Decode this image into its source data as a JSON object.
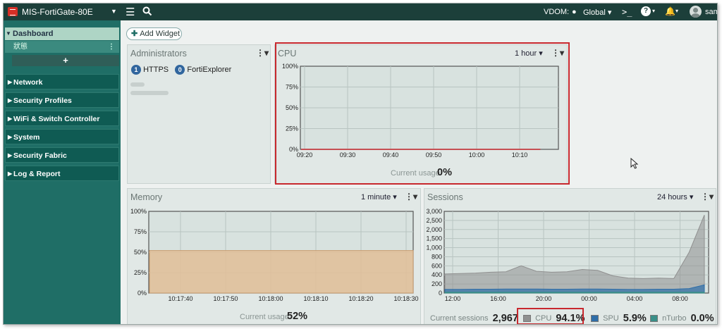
{
  "topbar": {
    "device_name": "MIS-FortiGate-80E",
    "vdom_label": "VDOM:",
    "vdom_value": "Global",
    "cli_symbol": ">_",
    "help_symbol": "?",
    "username": "sam"
  },
  "sidebar": {
    "dashboard": "Dashboard",
    "dashboard_sub": "狀態",
    "add_symbol": "+",
    "items": [
      "Network",
      "Security Profiles",
      "WiFi & Switch Controller",
      "System",
      "Security Fabric",
      "Log & Report"
    ]
  },
  "toolbar": {
    "add_widget": "Add Widget"
  },
  "widgets": {
    "administrators": {
      "title": "Administrators",
      "https_count": "1",
      "https_label": "HTTPS",
      "fe_count": "0",
      "fe_label": "FortiExplorer"
    },
    "cpu": {
      "title": "CPU",
      "range": "1 hour",
      "usage_label": "Current usage",
      "usage_value": "0%"
    },
    "memory": {
      "title": "Memory",
      "range": "1 minute",
      "usage_label": "Current usage",
      "usage_value": "52%"
    },
    "sessions": {
      "title": "Sessions",
      "range": "24 hours",
      "current_label": "Current sessions",
      "current_value": "2,967",
      "cpu_label": "CPU",
      "cpu_value": "94.1%",
      "spu_label": "SPU",
      "spu_value": "5.9%",
      "nturbo_label": "nTurbo",
      "nturbo_value": "0.0%"
    }
  },
  "colors": {
    "topbar": "#1c3f3a",
    "sidebar": "#1f6e66",
    "highlight": "#c8282e",
    "memory_fill": "#e2be98",
    "cpu_series": "#909090",
    "spu_series": "#2f6ea8",
    "nturbo_series": "#3a8f88"
  },
  "chart_data": [
    {
      "id": "cpu",
      "type": "line",
      "x": [
        "09:20",
        "09:30",
        "09:40",
        "09:50",
        "10:00",
        "10:10"
      ],
      "y_ticks": [
        "0%",
        "25%",
        "50%",
        "75%",
        "100%"
      ],
      "ylim": [
        0,
        100
      ],
      "series": [
        {
          "values": [
            0,
            0,
            0,
            0,
            0,
            0,
            0
          ]
        }
      ]
    },
    {
      "id": "memory",
      "type": "area",
      "x": [
        "10:17:40",
        "10:17:50",
        "10:18:00",
        "10:18:10",
        "10:18:20",
        "10:18:30"
      ],
      "y_ticks": [
        "0%",
        "25%",
        "50%",
        "75%",
        "100%"
      ],
      "ylim": [
        0,
        100
      ],
      "series": [
        {
          "values": [
            52,
            52,
            52,
            52,
            52,
            52,
            52
          ]
        }
      ]
    },
    {
      "id": "sessions",
      "type": "area",
      "x": [
        "12:00",
        "16:00",
        "20:00",
        "00:00",
        "04:00",
        "08:00"
      ],
      "y_ticks": [
        "0",
        "200",
        "400",
        "600",
        "800",
        "1,000",
        "1,500",
        "2,000",
        "2,500",
        "3,000"
      ],
      "ylim": [
        0,
        3000
      ],
      "series": [
        {
          "name": "CPU",
          "values": [
            420,
            430,
            440,
            460,
            470,
            600,
            480,
            460,
            470,
            520,
            500,
            380,
            330,
            320,
            330,
            320,
            900,
            2800
          ]
        },
        {
          "name": "SPU",
          "values": [
            80,
            80,
            85,
            85,
            90,
            90,
            90,
            85,
            85,
            90,
            90,
            85,
            80,
            80,
            85,
            85,
            100,
            180
          ]
        },
        {
          "name": "nTurbo",
          "values": [
            20,
            20,
            20,
            20,
            20,
            20,
            20,
            20,
            20,
            20,
            20,
            20,
            20,
            20,
            20,
            20,
            20,
            20
          ]
        }
      ]
    }
  ]
}
